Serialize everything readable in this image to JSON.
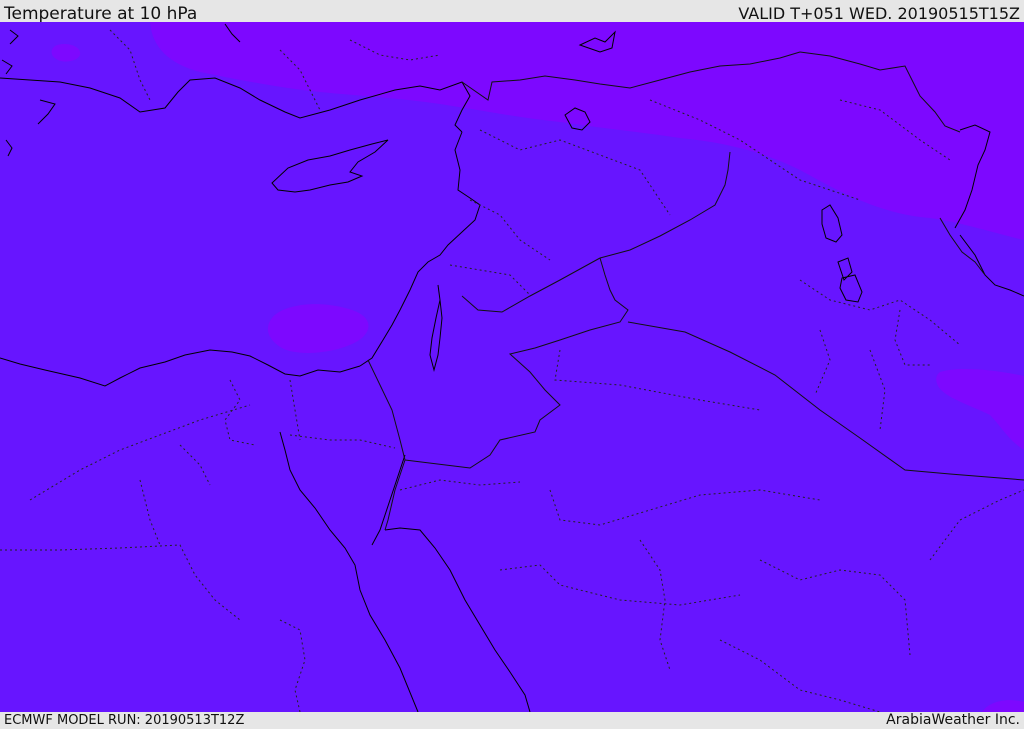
{
  "header": {
    "title": "Temperature at 10 hPa",
    "valid_time": "VALID T+051 WED. 20190515T15Z"
  },
  "footer": {
    "model_run": "ECMWF MODEL RUN: 20190513T12Z",
    "credit": "ArabiaWeather Inc."
  },
  "map": {
    "field": "Temperature at 10 hPa",
    "colors": {
      "base_fill": "#6715ff",
      "cold_fill": "#7d08ff",
      "coastline": "#000000",
      "border_line": "#222222"
    }
  }
}
